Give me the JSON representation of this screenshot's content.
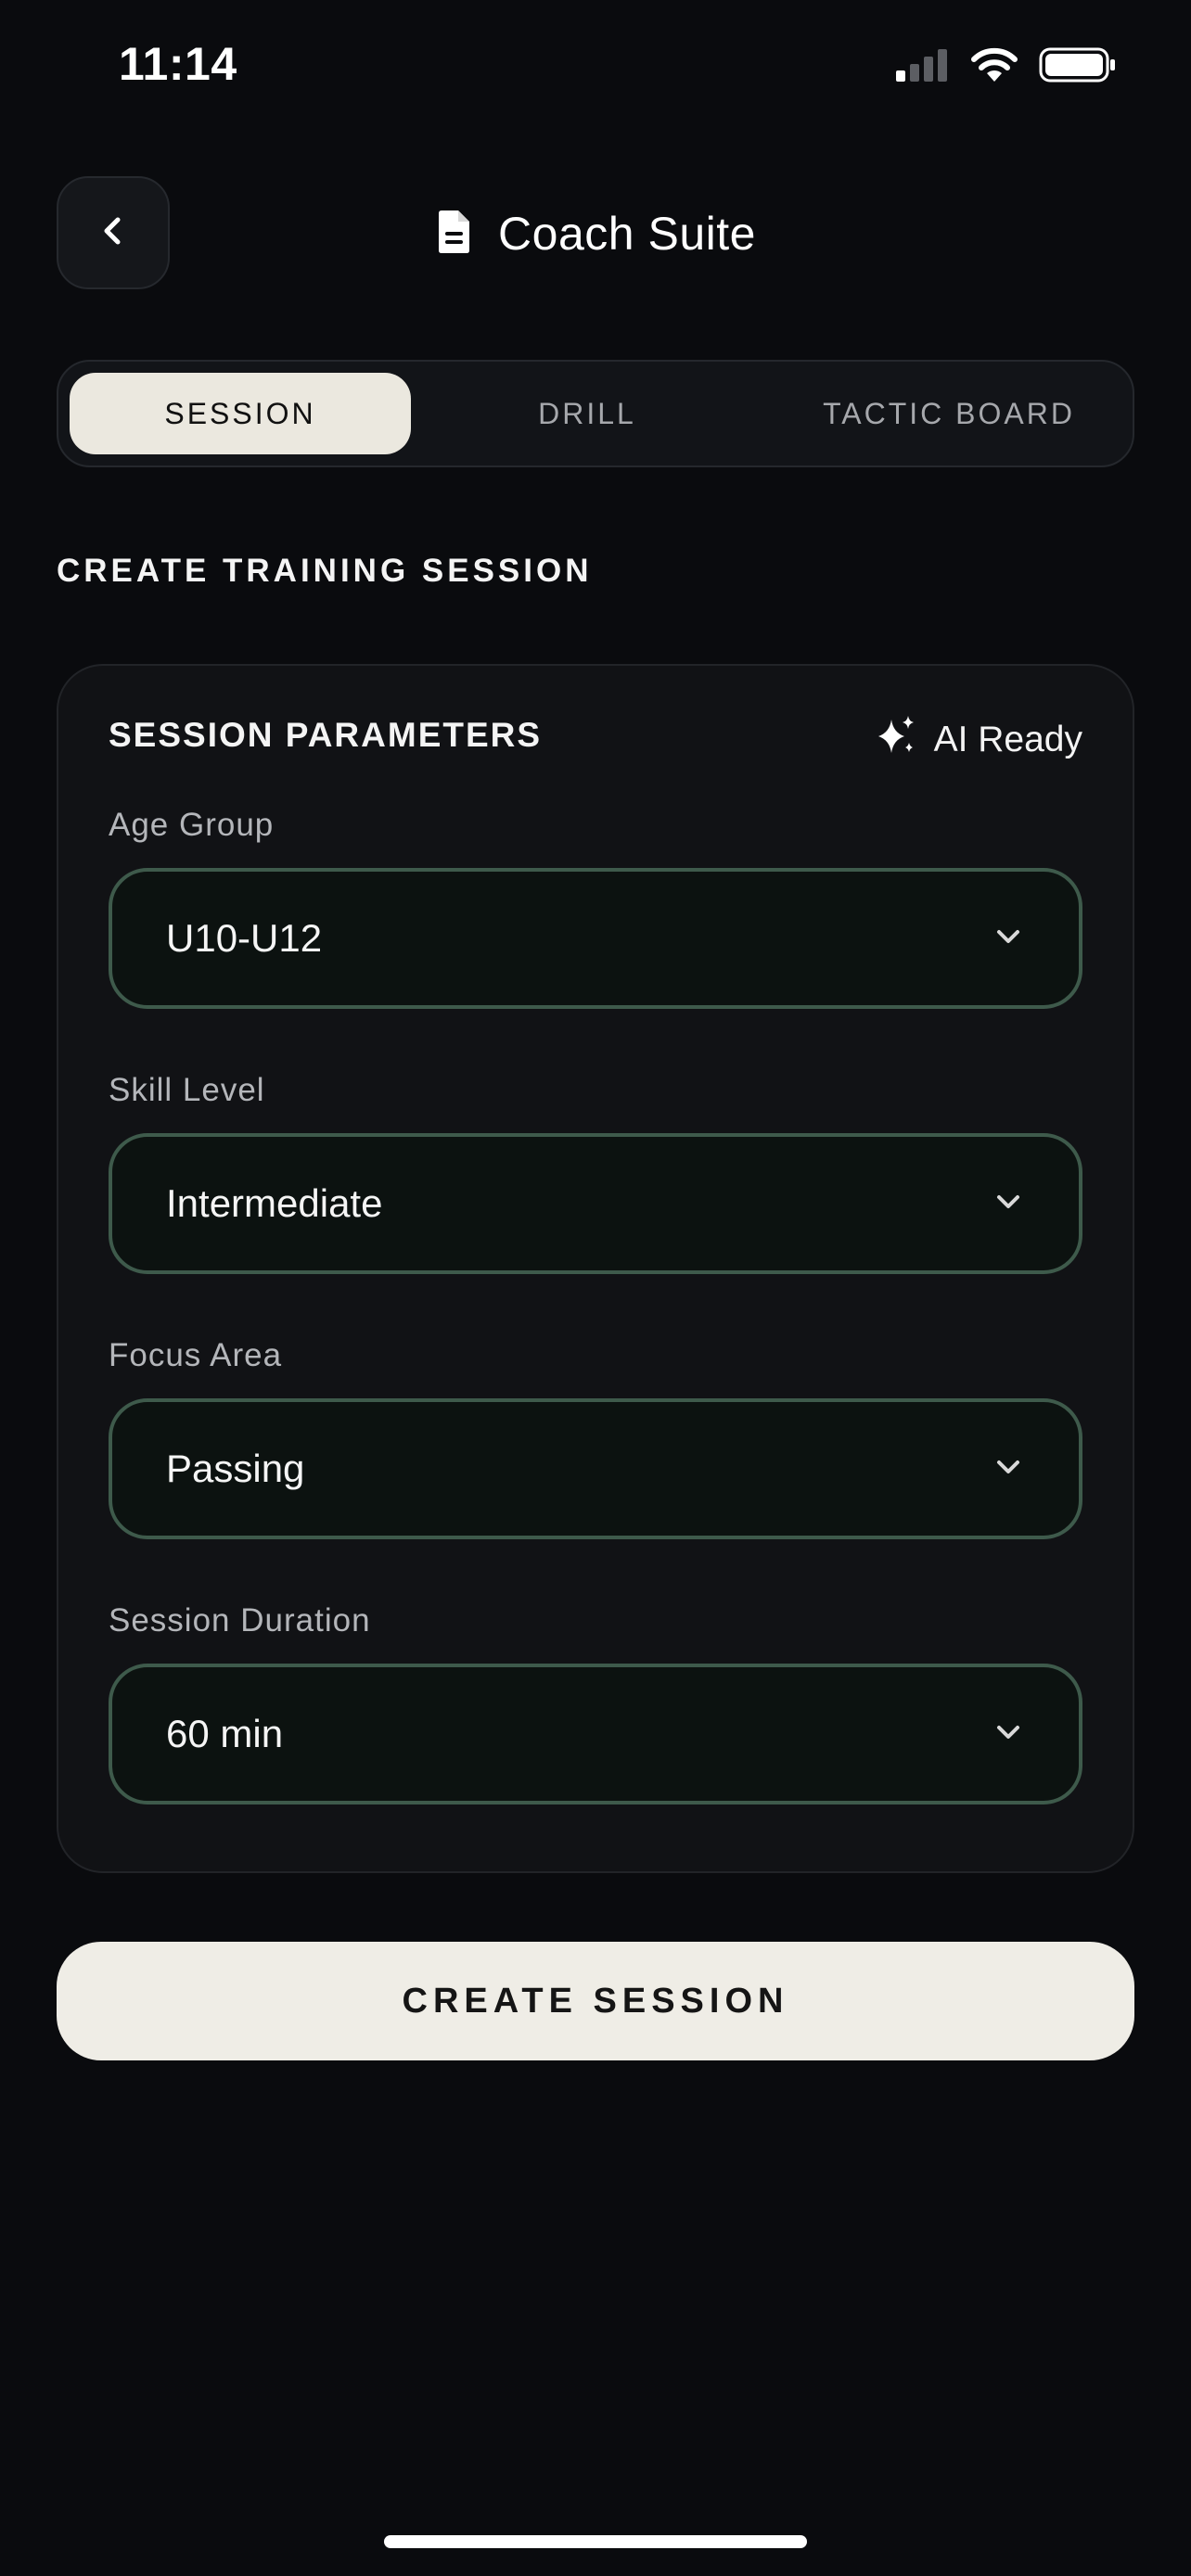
{
  "status_bar": {
    "time": "11:14",
    "icons": [
      "cellular-signal-icon",
      "wifi-icon",
      "battery-icon"
    ]
  },
  "header": {
    "back_icon": "chevron-left-icon",
    "title_icon": "document-icon",
    "title": "Coach Suite"
  },
  "tabs": [
    {
      "label": "SESSION",
      "active": true
    },
    {
      "label": "DRILL",
      "active": false
    },
    {
      "label": "TACTIC BOARD",
      "active": false
    }
  ],
  "section_heading": "CREATE TRAINING SESSION",
  "card": {
    "title": "SESSION PARAMETERS",
    "badge_icon": "sparkles-icon",
    "badge_label": "AI Ready",
    "fields": [
      {
        "label": "Age Group",
        "value": "U10-U12"
      },
      {
        "label": "Skill Level",
        "value": "Intermediate"
      },
      {
        "label": "Focus Area",
        "value": "Passing"
      },
      {
        "label": "Session Duration",
        "value": "60 min"
      }
    ]
  },
  "cta_label": "CREATE SESSION",
  "colors": {
    "background": "#0a0b0e",
    "accent_cream": "#efede6",
    "field_border_green": "#3e5a4b"
  }
}
